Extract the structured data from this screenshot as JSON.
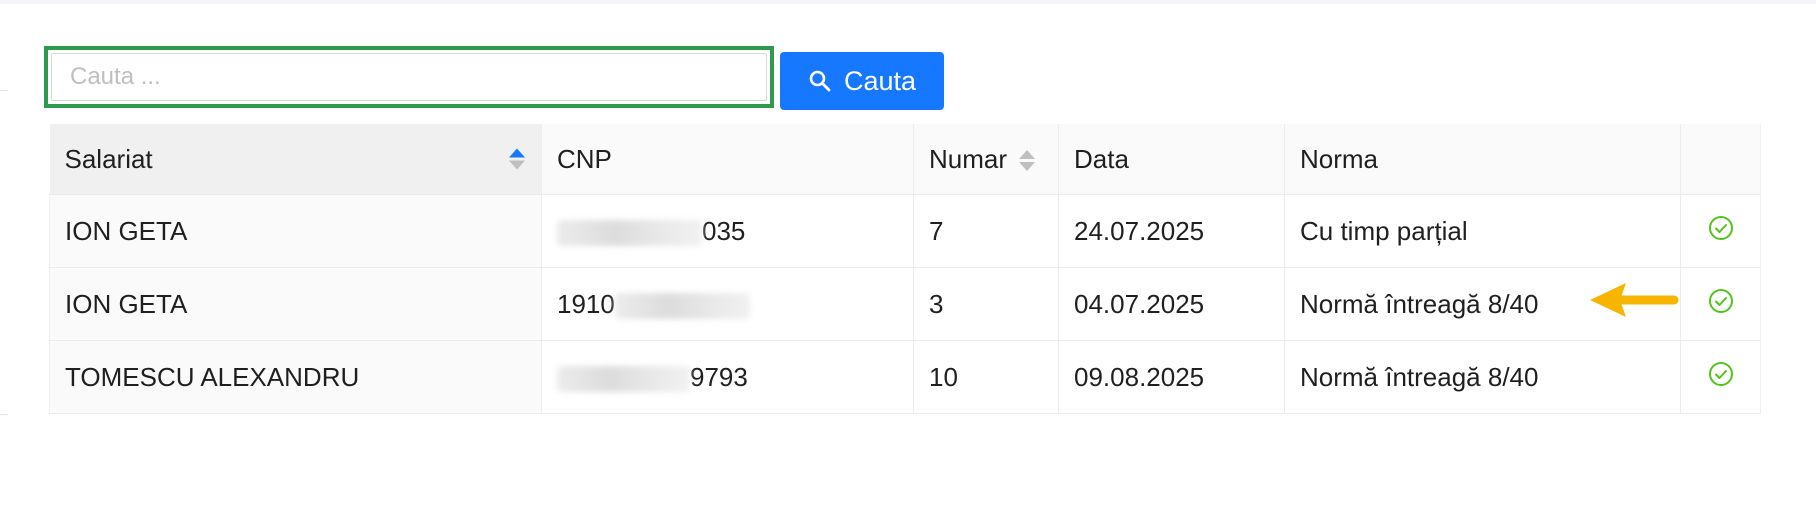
{
  "search": {
    "placeholder": "Cauta ...",
    "value": "",
    "button_label": "Cauta"
  },
  "table": {
    "columns": [
      "Salariat",
      "CNP",
      "Numar",
      "Data",
      "Norma",
      ""
    ],
    "rows": [
      {
        "salariat": "ION GETA",
        "cnp_visible": "035",
        "cnp_redacted_position": "start",
        "numar": "7",
        "data": "24.07.2025",
        "norma": "Cu timp parțial",
        "status": "check-circle-icon"
      },
      {
        "salariat": "ION GETA",
        "cnp_visible": "1910",
        "cnp_redacted_position": "end",
        "numar": "3",
        "data": "04.07.2025",
        "norma": "Normă întreagă 8/40",
        "status": "check-circle-icon"
      },
      {
        "salariat": "TOMESCU ALEXANDRU",
        "cnp_visible": "9793",
        "cnp_redacted_position": "start",
        "numar": "10",
        "data": "09.08.2025",
        "norma": "Normă întreagă 8/40",
        "status": "check-circle-icon"
      }
    ]
  },
  "colors": {
    "primary": "#1677ff",
    "highlight_border": "#2e9a4e",
    "success": "#52c41a",
    "annotation_arrow": "#f7b500"
  },
  "annotation": {
    "arrow_icon": "arrow-left-icon"
  }
}
